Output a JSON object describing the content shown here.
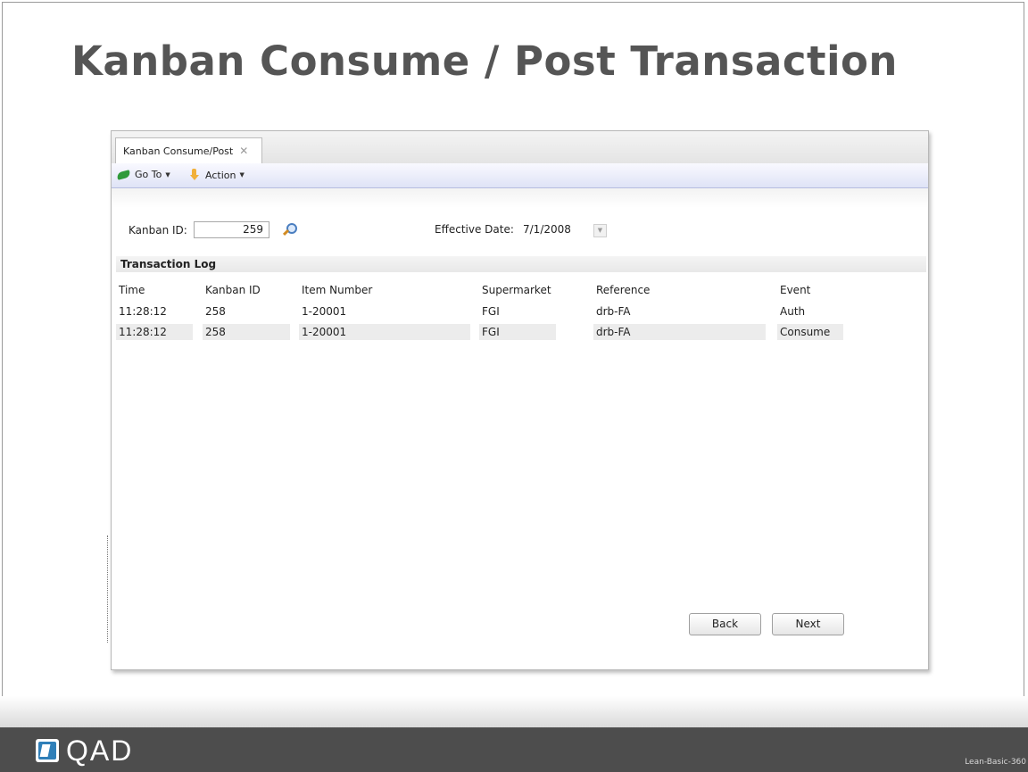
{
  "slide": {
    "title": "Kanban Consume / Post Transaction",
    "logo_text": "QAD",
    "code": "Lean-Basic-360"
  },
  "window": {
    "tab_label": "Kanban Consume/Post",
    "tab_close_glyph": "✕",
    "toolbar": {
      "goto_label": "Go To",
      "action_label": "Action",
      "caret": "▼"
    }
  },
  "form": {
    "kanban_id_label": "Kanban ID:",
    "kanban_id_value": "259",
    "effective_date_label": "Effective Date:",
    "effective_date_value": "7/1/2008"
  },
  "log": {
    "title": "Transaction Log",
    "columns": [
      "Time",
      "Kanban ID",
      "Item Number",
      "Supermarket",
      "Reference",
      "Event"
    ],
    "rows": [
      [
        "11:28:12",
        "258",
        "1-20001",
        "FGI",
        "drb-FA",
        "Auth"
      ],
      [
        "11:28:12",
        "258",
        "1-20001",
        "FGI",
        "drb-FA",
        "Consume"
      ]
    ]
  },
  "buttons": {
    "back": "Back",
    "next": "Next"
  },
  "icons": {
    "goto": "goto-icon",
    "action": "action-icon",
    "lookup": "lookup-icon",
    "date": "calendar-icon",
    "logo": "qad-logo-icon"
  },
  "colors": {
    "title": "#555555",
    "footer": "#4d4d4d",
    "toolbar": "#dfe3f6",
    "row_highlight": "#ececec"
  }
}
